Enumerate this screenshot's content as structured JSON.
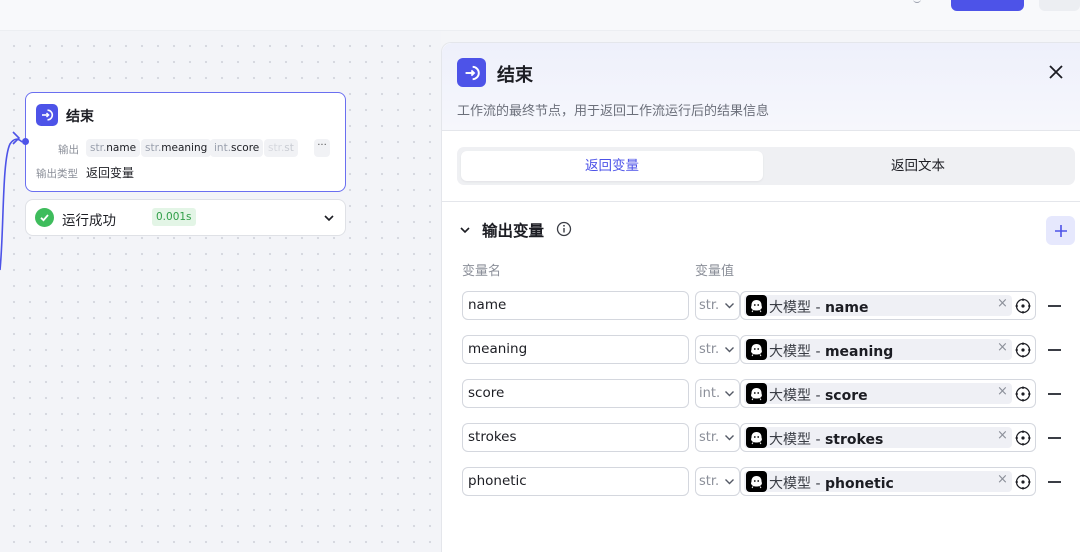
{
  "node": {
    "title": "结束",
    "output_label": "输出",
    "output_chips": [
      {
        "type": "str.",
        "name": "name"
      },
      {
        "type": "str.",
        "name": "meaning"
      },
      {
        "type": "int.",
        "name": "score"
      },
      {
        "type": "str.",
        "name": "st"
      }
    ],
    "more_label": "···",
    "type_label": "输出类型",
    "type_value": "返回变量"
  },
  "run_status": {
    "label": "运行成功",
    "time": "0.001s"
  },
  "panel": {
    "title": "结束",
    "description": "工作流的最终节点，用于返回工作流运行后的结果信息",
    "tabs": [
      {
        "label": "返回变量",
        "active": true
      },
      {
        "label": "返回文本",
        "active": false
      }
    ],
    "section_title": "输出变量",
    "col_name": "变量名",
    "col_value": "变量值",
    "rows": [
      {
        "name": "name",
        "type": "str.",
        "model": "大模型",
        "field": "name"
      },
      {
        "name": "meaning",
        "type": "str.",
        "model": "大模型",
        "field": "meaning"
      },
      {
        "name": "score",
        "type": "int.",
        "model": "大模型",
        "field": "score"
      },
      {
        "name": "strokes",
        "type": "str.",
        "model": "大模型",
        "field": "strokes"
      },
      {
        "name": "phonetic",
        "type": "str.",
        "model": "大模型",
        "field": "phonetic"
      }
    ]
  },
  "colors": {
    "accent": "#4d53e8",
    "success": "#3ebc5c"
  },
  "icons": [
    "end-node-icon",
    "check-icon",
    "chevron-down-icon",
    "close-icon",
    "info-icon",
    "plus-icon",
    "llm-model-icon",
    "clear-icon",
    "target-icon",
    "minus-icon"
  ]
}
